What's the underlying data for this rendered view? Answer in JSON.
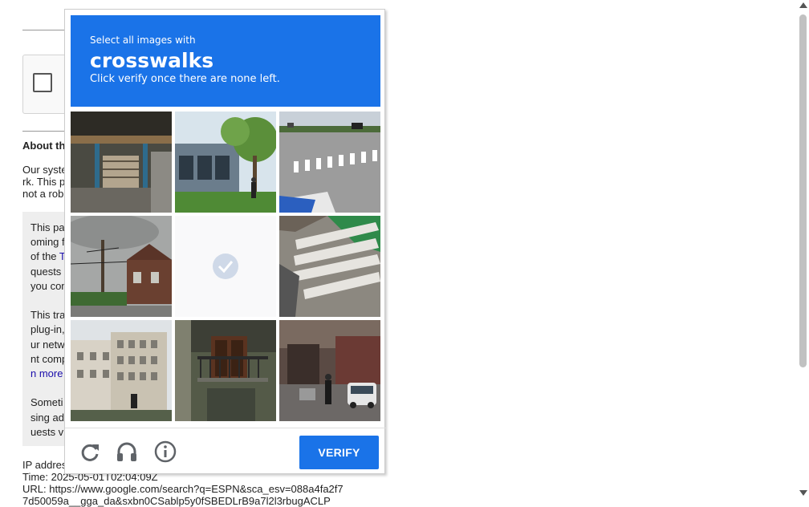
{
  "background_page": {
    "about_heading": "About th",
    "para1": [
      "Our syste",
      "rk. This p",
      "not a robo"
    ],
    "box_lines": [
      {
        "text": "This pa"
      },
      {
        "text": "oming f"
      },
      {
        "text": "of the ",
        "link": "T"
      },
      {
        "text": "quests "
      },
      {
        "text": "you con"
      },
      {
        "text": ""
      },
      {
        "text": "This tra"
      },
      {
        "text": "plug-in,"
      },
      {
        "text": "ur netw"
      },
      {
        "text": "nt comp"
      },
      {
        "text": "",
        "link": "n more"
      },
      {
        "text": ""
      },
      {
        "text": "Someti"
      },
      {
        "text": "sing ad"
      },
      {
        "text": "uests v"
      }
    ],
    "ip_label": "IP addres",
    "time_line": "Time: 2025-05-01T02:04:09Z",
    "url_line": "URL: https://www.google.com/search?q=ESPN&sca_esv=088a4fa2f7",
    "url_line2": "7d50059a__gga_da&sxbn0CSablp5y0fSBEDLrB9a7l2l3rbugACLP"
  },
  "challenge": {
    "instruction_line1": "Select all images with",
    "target": "crosswalks",
    "instruction_line3": "Click verify once there are none left.",
    "header_color": "#1a73e8",
    "tiles": [
      {
        "scene": "building-stairs-closeup",
        "faded": false
      },
      {
        "scene": "building-with-trees-pedestrian",
        "faded": false
      },
      {
        "scene": "road-with-crosswalk",
        "faded": false
      },
      {
        "scene": "street-utility-pole-cloudy",
        "faded": false
      },
      {
        "scene": "loading-tile",
        "faded": true
      },
      {
        "scene": "crosswalk-stripes-closeup",
        "faded": false
      },
      {
        "scene": "modern-apartment-building",
        "faded": false
      },
      {
        "scene": "apartment-balcony",
        "faded": false
      },
      {
        "scene": "city-street-with-cars",
        "faded": false
      }
    ],
    "footer": {
      "reload_icon": "reload-icon",
      "audio_icon": "headphones-icon",
      "info_icon": "info-icon",
      "verify_label": "VERIFY"
    }
  }
}
